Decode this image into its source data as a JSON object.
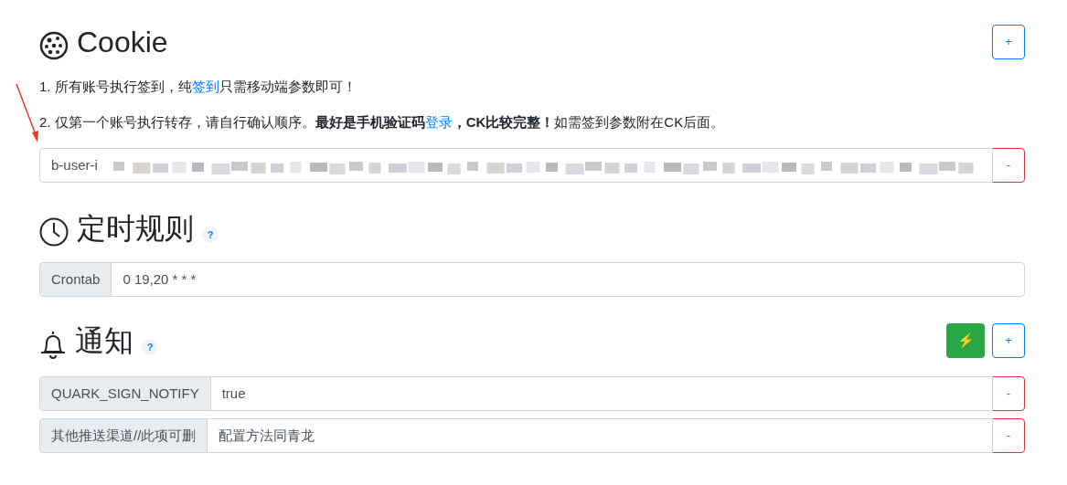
{
  "cookie": {
    "title": "Cookie",
    "add_button": "+",
    "notes": [
      [
        {
          "kind": "text",
          "text": "1. 所有账号执行签到，纯"
        },
        {
          "kind": "link",
          "text": "签到"
        },
        {
          "kind": "text",
          "text": "只需移动端参数即可！"
        }
      ],
      [
        {
          "kind": "text",
          "text": "2. 仅第一个账号执行转存，请自行确认顺序。**最好是手机验证码**"
        },
        {
          "kind": "link",
          "text": "登录"
        },
        {
          "kind": "text",
          "text": "**，CK比较完整！**如需签到参数附在CK后面。"
        }
      ]
    ],
    "entries": [
      {
        "value": "b-user-i",
        "remove_button": "-"
      }
    ]
  },
  "schedule": {
    "title": "定时规则",
    "help": "?",
    "rows": [
      {
        "label": "Crontab",
        "value": "0 19,20 * * *"
      }
    ]
  },
  "notify": {
    "title": "通知",
    "help": "?",
    "test_button": "⚡",
    "add_button": "+",
    "rows": [
      {
        "label": "QUARK_SIGN_NOTIFY",
        "value": "true",
        "remove_button": "-"
      },
      {
        "label": "其他推送渠道//此项可删",
        "value": "配置方法同青龙",
        "remove_button": "-"
      }
    ]
  }
}
